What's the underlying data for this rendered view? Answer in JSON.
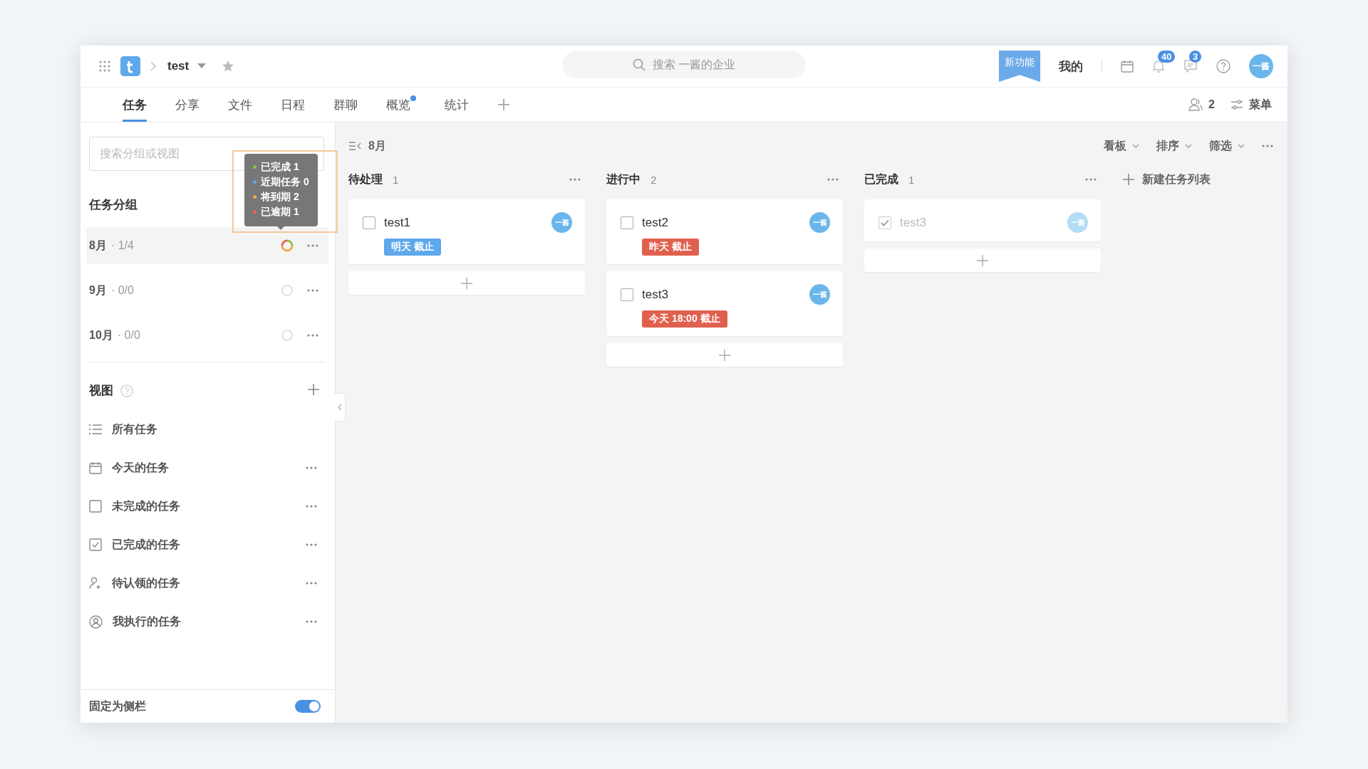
{
  "topbar": {
    "project": "test",
    "search_placeholder": "搜索 一酱的企业",
    "new_feature": "新功能",
    "mine": "我的",
    "notification_count": "40",
    "message_count": "3",
    "avatar": "一酱"
  },
  "tabs": [
    {
      "label": "任务",
      "selected": true,
      "dot": false
    },
    {
      "label": "分享",
      "selected": false,
      "dot": false
    },
    {
      "label": "文件",
      "selected": false,
      "dot": false
    },
    {
      "label": "日程",
      "selected": false,
      "dot": false
    },
    {
      "label": "群聊",
      "selected": false,
      "dot": false
    },
    {
      "label": "概览",
      "selected": false,
      "dot": true
    },
    {
      "label": "统计",
      "selected": false,
      "dot": false
    }
  ],
  "tabbar_right": {
    "members": "2",
    "menu": "菜单"
  },
  "sidebar": {
    "search_placeholder": "搜索分组或视图",
    "groups_title": "任务分组",
    "groups": [
      {
        "name": "8月",
        "progress": "· 1/4",
        "selected": true
      },
      {
        "name": "9月",
        "progress": "· 0/0",
        "selected": false
      },
      {
        "name": "10月",
        "progress": "· 0/0",
        "selected": false
      }
    ],
    "tooltip": [
      {
        "label": "已完成 1",
        "color": "#8bc34a"
      },
      {
        "label": "近期任务 0",
        "color": "#5ea8ec"
      },
      {
        "label": "将到期 2",
        "color": "#f0a848"
      },
      {
        "label": "已逾期 1",
        "color": "#e8685a"
      }
    ],
    "views_title": "视图",
    "views": [
      {
        "kind": "list",
        "label": "所有任务",
        "more": false
      },
      {
        "kind": "calendar",
        "label": "今天的任务",
        "more": true
      },
      {
        "kind": "box",
        "label": "未完成的任务",
        "more": true
      },
      {
        "kind": "checkbox",
        "label": "已完成的任务",
        "more": true
      },
      {
        "kind": "person-add",
        "label": "待认领的任务",
        "more": true
      },
      {
        "kind": "person-circle",
        "label": "我执行的任务",
        "more": true
      }
    ],
    "pin_label": "固定为侧栏",
    "pin_on": true
  },
  "board": {
    "group": "8月",
    "controls": [
      "看板",
      "排序",
      "筛选"
    ],
    "columns": [
      {
        "title": "待处理",
        "count": "1",
        "cards": [
          {
            "title": "test1",
            "checked": false,
            "assignee": "一酱",
            "due": {
              "text": "明天 截止",
              "color": "#5ea8ec"
            }
          }
        ]
      },
      {
        "title": "进行中",
        "count": "2",
        "cards": [
          {
            "title": "test2",
            "checked": false,
            "assignee": "一酱",
            "due": {
              "text": "昨天 截止",
              "color": "#e0604e"
            }
          },
          {
            "title": "test3",
            "checked": false,
            "assignee": "一酱",
            "due": {
              "text": "今天 18:00 截止",
              "color": "#e0604e"
            }
          }
        ]
      },
      {
        "title": "已完成",
        "count": "1",
        "cards": [
          {
            "title": "test3",
            "checked": true,
            "assignee": "一酱"
          }
        ]
      }
    ],
    "new_list": "新建任务列表"
  }
}
